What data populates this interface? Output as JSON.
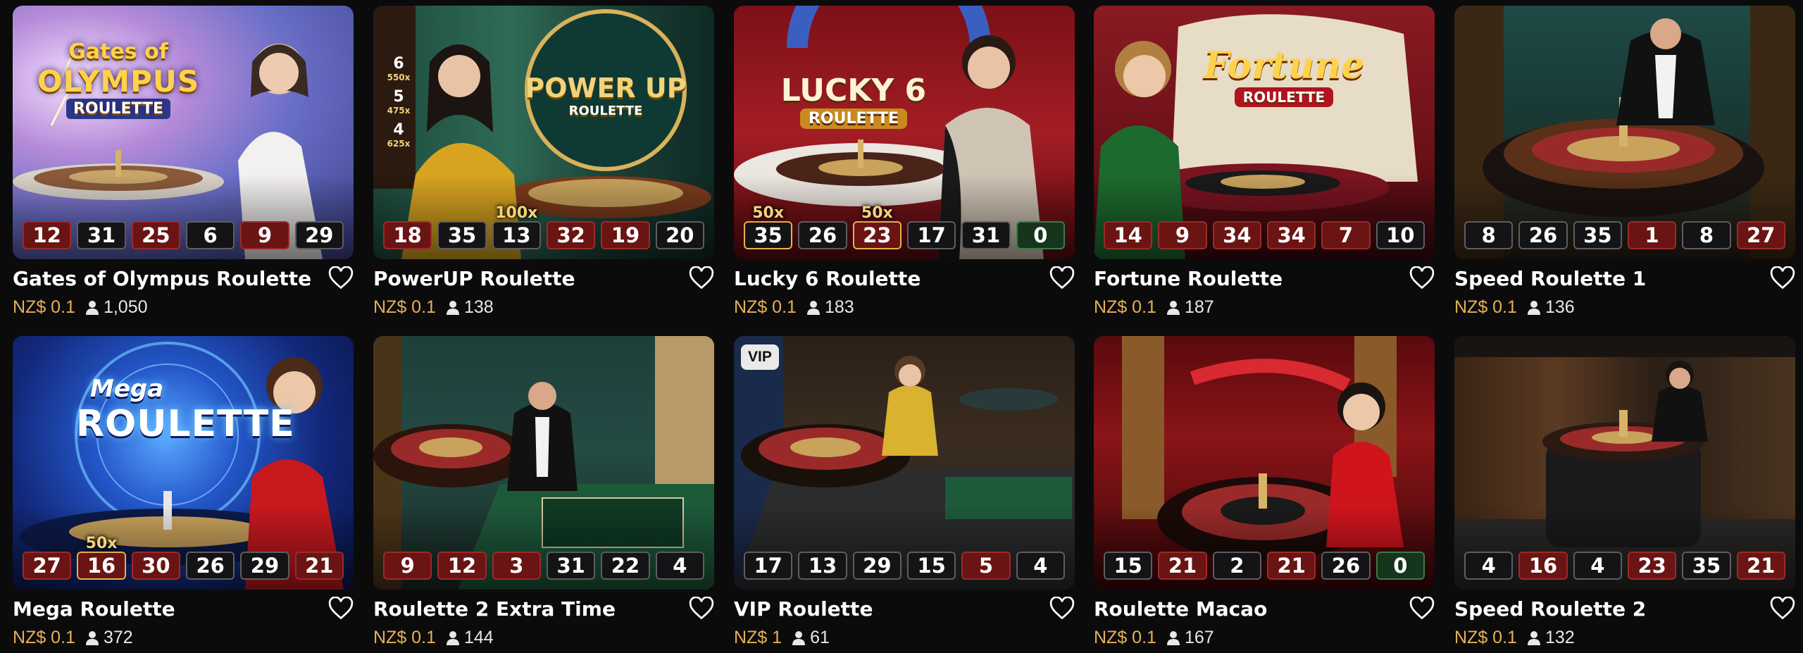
{
  "colors": {
    "background": "#0b0b0c",
    "price": "#e7b055",
    "red_ball": "#6a1414",
    "black_ball": "#141416",
    "green_ball": "#16351d",
    "multiplier": "#f4d27a"
  },
  "icons": {
    "favorite": "heart-outline-icon",
    "players": "person-icon"
  },
  "games": [
    {
      "title": "Gates of Olympus Roulette",
      "price": "NZ$ 0.1",
      "players": "1,050",
      "logo_lines": [
        "Gates of",
        "OLYMPUS",
        "ROULETTE"
      ],
      "results": [
        {
          "value": "12",
          "color": "red"
        },
        {
          "value": "31",
          "color": "black"
        },
        {
          "value": "25",
          "color": "red"
        },
        {
          "value": "6",
          "color": "black"
        },
        {
          "value": "9",
          "color": "red"
        },
        {
          "value": "29",
          "color": "black"
        }
      ]
    },
    {
      "title": "PowerUP Roulette",
      "price": "NZ$ 0.1",
      "players": "138",
      "logo_lines": [
        "POWER UP",
        "ROULETTE"
      ],
      "side_values": [
        "6",
        "550x",
        "5",
        "475x",
        "4",
        "625x"
      ],
      "results": [
        {
          "value": "18",
          "color": "red"
        },
        {
          "value": "35",
          "color": "black"
        },
        {
          "value": "13",
          "color": "black",
          "multiplier": "100x"
        },
        {
          "value": "32",
          "color": "red"
        },
        {
          "value": "19",
          "color": "red"
        },
        {
          "value": "20",
          "color": "black"
        }
      ]
    },
    {
      "title": "Lucky 6 Roulette",
      "price": "NZ$ 0.1",
      "players": "183",
      "logo_lines": [
        "LUCKY 6",
        "ROULETTE"
      ],
      "results": [
        {
          "value": "35",
          "color": "black",
          "multiplier": "50x",
          "highlight": true
        },
        {
          "value": "26",
          "color": "black"
        },
        {
          "value": "23",
          "color": "red",
          "multiplier": "50x",
          "highlight": true
        },
        {
          "value": "17",
          "color": "black"
        },
        {
          "value": "31",
          "color": "black"
        },
        {
          "value": "0",
          "color": "green"
        }
      ]
    },
    {
      "title": "Fortune Roulette",
      "price": "NZ$ 0.1",
      "players": "187",
      "logo_lines": [
        "Fortune",
        "ROULETTE"
      ],
      "results": [
        {
          "value": "14",
          "color": "red"
        },
        {
          "value": "9",
          "color": "red"
        },
        {
          "value": "34",
          "color": "red"
        },
        {
          "value": "34",
          "color": "red"
        },
        {
          "value": "7",
          "color": "red"
        },
        {
          "value": "10",
          "color": "black"
        }
      ]
    },
    {
      "title": "Speed Roulette 1",
      "price": "NZ$ 0.1",
      "players": "136",
      "results": [
        {
          "value": "8",
          "color": "black"
        },
        {
          "value": "26",
          "color": "black"
        },
        {
          "value": "35",
          "color": "black"
        },
        {
          "value": "1",
          "color": "red"
        },
        {
          "value": "8",
          "color": "black"
        },
        {
          "value": "27",
          "color": "red"
        }
      ]
    },
    {
      "title": "Mega Roulette",
      "price": "NZ$ 0.1",
      "players": "372",
      "logo_lines": [
        "Mega",
        "ROULETTE"
      ],
      "results": [
        {
          "value": "27",
          "color": "red"
        },
        {
          "value": "16",
          "color": "red",
          "multiplier": "50x",
          "highlight": true
        },
        {
          "value": "30",
          "color": "red"
        },
        {
          "value": "26",
          "color": "black"
        },
        {
          "value": "29",
          "color": "black"
        },
        {
          "value": "21",
          "color": "red"
        }
      ]
    },
    {
      "title": "Roulette 2 Extra Time",
      "price": "NZ$ 0.1",
      "players": "144",
      "results": [
        {
          "value": "9",
          "color": "red"
        },
        {
          "value": "12",
          "color": "red"
        },
        {
          "value": "3",
          "color": "red"
        },
        {
          "value": "31",
          "color": "black"
        },
        {
          "value": "22",
          "color": "black"
        },
        {
          "value": "4",
          "color": "black"
        }
      ]
    },
    {
      "title": "VIP Roulette",
      "price": "NZ$ 1",
      "players": "61",
      "badge": "VIP",
      "results": [
        {
          "value": "17",
          "color": "black"
        },
        {
          "value": "13",
          "color": "black"
        },
        {
          "value": "29",
          "color": "black"
        },
        {
          "value": "15",
          "color": "black"
        },
        {
          "value": "5",
          "color": "red"
        },
        {
          "value": "4",
          "color": "black"
        }
      ]
    },
    {
      "title": "Roulette Macao",
      "price": "NZ$ 0.1",
      "players": "167",
      "results": [
        {
          "value": "15",
          "color": "black"
        },
        {
          "value": "21",
          "color": "red"
        },
        {
          "value": "2",
          "color": "black"
        },
        {
          "value": "21",
          "color": "red"
        },
        {
          "value": "26",
          "color": "black"
        },
        {
          "value": "0",
          "color": "green"
        }
      ]
    },
    {
      "title": "Speed Roulette 2",
      "price": "NZ$ 0.1",
      "players": "132",
      "results": [
        {
          "value": "4",
          "color": "black"
        },
        {
          "value": "16",
          "color": "red"
        },
        {
          "value": "4",
          "color": "black"
        },
        {
          "value": "23",
          "color": "red"
        },
        {
          "value": "35",
          "color": "black"
        },
        {
          "value": "21",
          "color": "red"
        }
      ]
    }
  ]
}
